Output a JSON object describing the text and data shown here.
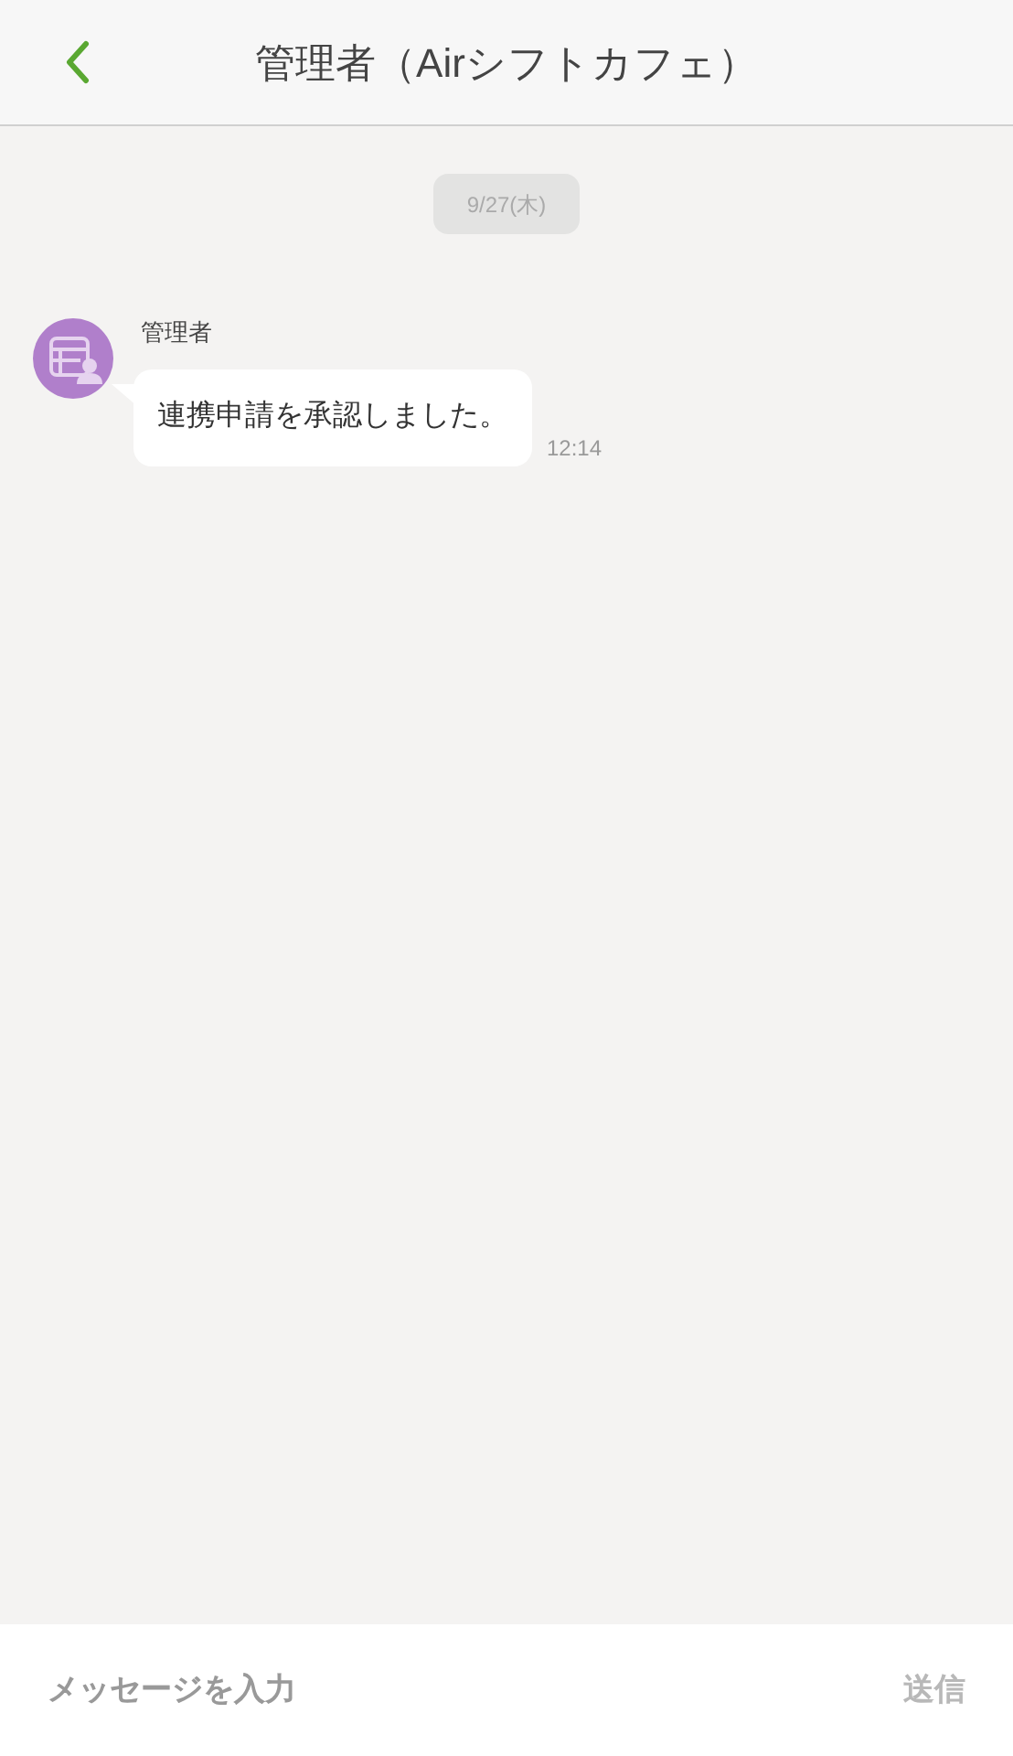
{
  "header": {
    "title": "管理者（Airシフトカフェ）"
  },
  "date_label": "9/27(木)",
  "messages": [
    {
      "sender": "管理者",
      "text": "連携申請を承認しました。",
      "time": "12:14"
    }
  ],
  "composer": {
    "placeholder": "メッセージを入力",
    "send": {
      "label": "送信",
      "disabled": true
    }
  }
}
